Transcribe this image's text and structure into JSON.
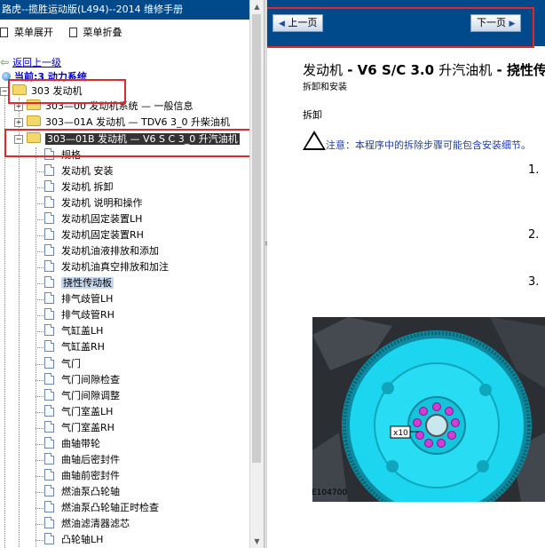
{
  "left": {
    "title": "路虎--揽胜运动版(L494)--2014 维修手册",
    "menu_expand": "菜单展开",
    "menu_collapse": "菜单折叠",
    "back_link": "返回上一级",
    "current": "当前:3 动力系统",
    "tree": {
      "root": "303 发动机",
      "n1": "303—00 发动机系统 — 一般信息",
      "n2": "303—01A 发动机 — TDV6 3_0 升柴油机",
      "n3": "303—01B 发动机 — V6 S C 3_0 升汽油机",
      "leaves": [
        "规格",
        "发动机 安装",
        "发动机 拆卸",
        "发动机 说明和操作",
        "发动机固定装置LH",
        "发动机固定装置RH",
        "发动机油液排放和添加",
        "发动机油真空排放和加注",
        "挠性传动板",
        "排气歧管LH",
        "排气歧管RH",
        "气缸盖LH",
        "气缸盖RH",
        "气门",
        "气门间隙检查",
        "气门间隙调整",
        "气门室盖LH",
        "气门室盖RH",
        "曲轴带轮",
        "曲轴后密封件",
        "曲轴前密封件",
        "燃油泵凸轮轴",
        "燃油泵凸轮轴正时检查",
        "燃油滤清器滤芯",
        "凸轮轴LH"
      ]
    }
  },
  "right": {
    "prev_label": "上一页",
    "next_label": "下一页",
    "title_pre": "发动机",
    "title_bold": " - V6 S/C 3.0 ",
    "title_mid": "升汽油机",
    "title_tail": " - 挠性传",
    "subtitle": "拆卸和安装",
    "section": "拆卸",
    "caution": "注意：本程序中的拆除步骤可能包含安装细节。",
    "steps": [
      "1.",
      "2.",
      "3."
    ],
    "figure_label": "E104700",
    "figure_callout": "x10"
  },
  "colors": {
    "header_blue": "#004a8c",
    "flywheel": "#19d7ee",
    "bolt": "#d23cd7",
    "highlight_red": "#e02a2a"
  }
}
